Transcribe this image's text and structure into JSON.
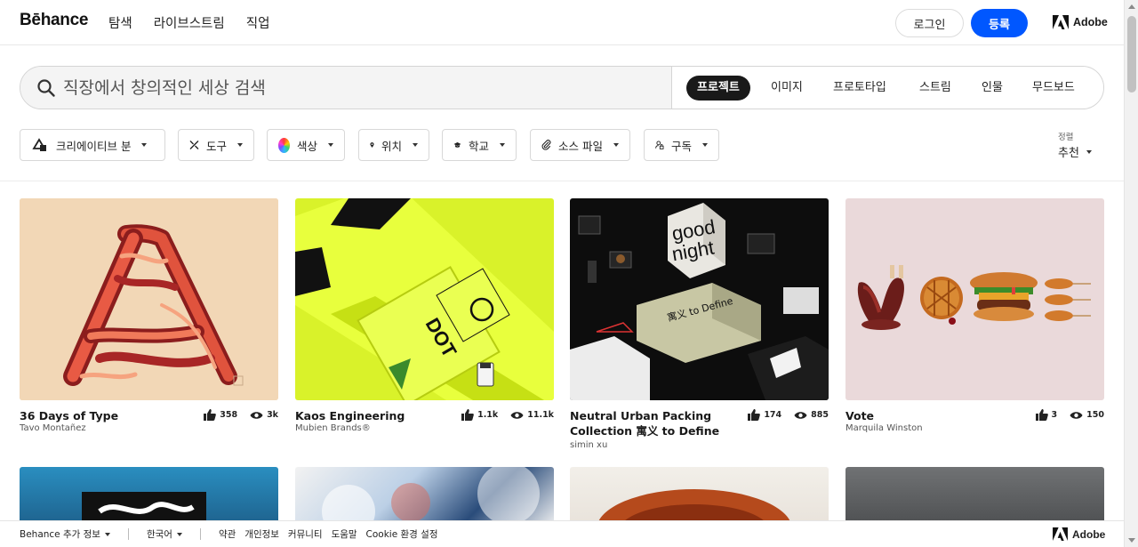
{
  "nav": {
    "logo": "Bēhance",
    "links": [
      "탐색",
      "라이브스트림",
      "직업"
    ],
    "login": "로그인",
    "join": "등록",
    "adobe": "Adobe"
  },
  "search": {
    "placeholder": "직장에서 창의적인 세상 검색",
    "scopes": [
      "프로젝트",
      "이미지",
      "프로토타입",
      "스트림",
      "인물",
      "무드보드"
    ],
    "active_scope": "프로젝트"
  },
  "filters": [
    {
      "label": "크리에이티브 분",
      "icon": "creative-fields-icon"
    },
    {
      "label": "도구",
      "icon": "tools-icon"
    },
    {
      "label": "색상",
      "icon": "color-wheel-icon"
    },
    {
      "label": "위치",
      "icon": "location-pin-icon"
    },
    {
      "label": "학교",
      "icon": "graduation-cap-icon"
    },
    {
      "label": "소스 파일",
      "icon": "paperclip-icon"
    },
    {
      "label": "구독",
      "icon": "subscription-icon"
    }
  ],
  "sort": {
    "label": "정렬",
    "value": "추천"
  },
  "projects": [
    {
      "title": "36 Days of Type",
      "owner": "Tavo Montañez",
      "likes": "358",
      "views": "3k"
    },
    {
      "title": "Kaos Engineering",
      "owner": "Mubien Brands®",
      "likes": "1.1k",
      "views": "11.1k"
    },
    {
      "title": "Neutral Urban Packing Collection 寓义 to Define",
      "title_line1": "Neutral Urban Packing",
      "title_line2": "Collection 寓义 to Define",
      "owner": "simin xu",
      "likes": "174",
      "views": "885"
    },
    {
      "title": "Vote",
      "owner": "Marquila Winston",
      "likes": "3",
      "views": "150"
    }
  ],
  "artwork_text": {
    "dot": "DOT",
    "good": "good",
    "night": "night",
    "to_define": "寓义 to Define"
  },
  "footer": {
    "more": "Behance 추가 정보",
    "language": "한국어",
    "links": [
      "약관",
      "개인정보",
      "커뮤니티",
      "도움말",
      "Cookie 환경 설정"
    ],
    "adobe": "Adobe"
  }
}
